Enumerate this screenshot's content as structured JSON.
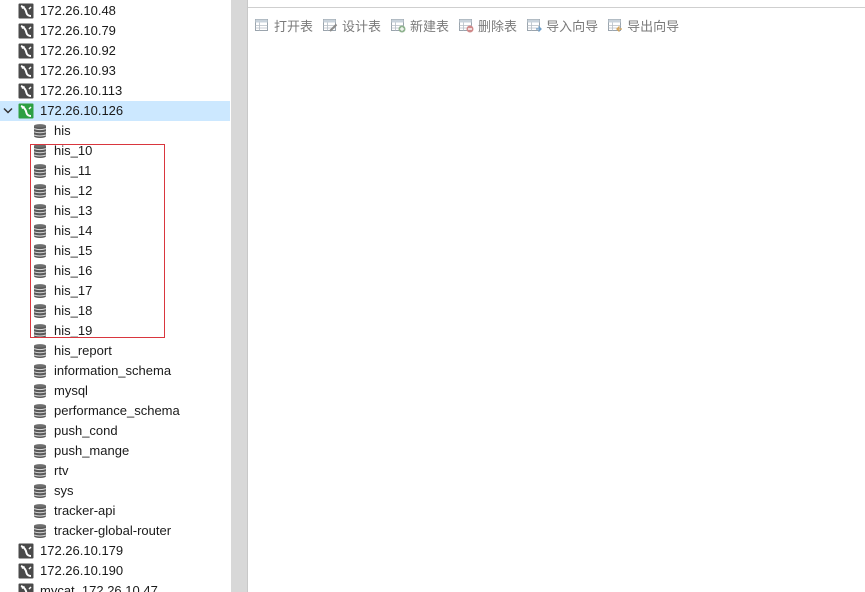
{
  "tree": [
    {
      "kind": "conn",
      "label": "172.26.10.48",
      "state": "closed"
    },
    {
      "kind": "conn",
      "label": "172.26.10.79",
      "state": "closed"
    },
    {
      "kind": "conn",
      "label": "172.26.10.92",
      "state": "closed"
    },
    {
      "kind": "conn",
      "label": "172.26.10.93",
      "state": "closed"
    },
    {
      "kind": "conn",
      "label": "172.26.10.113",
      "state": "closed"
    },
    {
      "kind": "conn",
      "label": "172.26.10.126",
      "state": "open",
      "expanded": true,
      "selected": true
    },
    {
      "kind": "db",
      "label": "his"
    },
    {
      "kind": "db",
      "label": "his_10"
    },
    {
      "kind": "db",
      "label": "his_11"
    },
    {
      "kind": "db",
      "label": "his_12"
    },
    {
      "kind": "db",
      "label": "his_13"
    },
    {
      "kind": "db",
      "label": "his_14"
    },
    {
      "kind": "db",
      "label": "his_15"
    },
    {
      "kind": "db",
      "label": "his_16"
    },
    {
      "kind": "db",
      "label": "his_17"
    },
    {
      "kind": "db",
      "label": "his_18"
    },
    {
      "kind": "db",
      "label": "his_19"
    },
    {
      "kind": "db",
      "label": "his_report"
    },
    {
      "kind": "db",
      "label": "information_schema"
    },
    {
      "kind": "db",
      "label": "mysql"
    },
    {
      "kind": "db",
      "label": "performance_schema"
    },
    {
      "kind": "db",
      "label": "push_cond"
    },
    {
      "kind": "db",
      "label": "push_mange"
    },
    {
      "kind": "db",
      "label": "rtv"
    },
    {
      "kind": "db",
      "label": "sys"
    },
    {
      "kind": "db",
      "label": "tracker-api"
    },
    {
      "kind": "db",
      "label": "tracker-global-router"
    },
    {
      "kind": "conn",
      "label": "172.26.10.179",
      "state": "closed"
    },
    {
      "kind": "conn",
      "label": "172.26.10.190",
      "state": "closed"
    },
    {
      "kind": "conn",
      "label": "mycat_172.26.10.47",
      "state": "closed"
    }
  ],
  "toolbar": {
    "buttons": [
      {
        "label": "打开表",
        "icon": "open-table-icon"
      },
      {
        "label": "设计表",
        "icon": "design-table-icon"
      },
      {
        "label": "新建表",
        "icon": "new-table-icon"
      },
      {
        "label": "删除表",
        "icon": "delete-table-icon"
      },
      {
        "label": "导入向导",
        "icon": "import-wizard-icon"
      },
      {
        "label": "导出向导",
        "icon": "export-wizard-icon"
      }
    ]
  },
  "colors": {
    "selected_bg": "#cce8ff",
    "connection_open": "#2ea043",
    "connection_closed": "#4a4a4a",
    "highlight_border": "#d9363e",
    "toolbar_text": "#7a7a7a"
  }
}
